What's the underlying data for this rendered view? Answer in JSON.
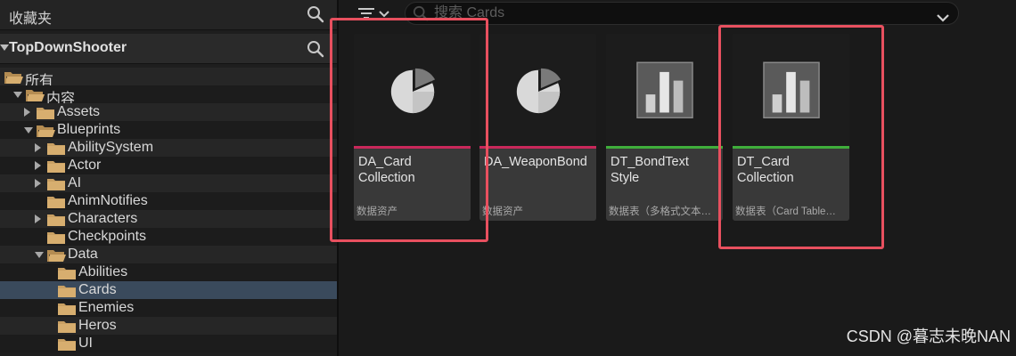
{
  "left_panel": {
    "favorites_label": "收藏夹",
    "project_name": "TopDownShooter",
    "tree": [
      {
        "label": "所有",
        "level": 0,
        "twisty": "none",
        "open_folder": true
      },
      {
        "label": "内容",
        "level": 1,
        "twisty": "open",
        "open_folder": true
      },
      {
        "label": "Assets",
        "level": 2,
        "twisty": "closed",
        "open_folder": false
      },
      {
        "label": "Blueprints",
        "level": 2,
        "twisty": "open",
        "open_folder": true
      },
      {
        "label": "AbilitySystem",
        "level": 3,
        "twisty": "closed",
        "open_folder": false
      },
      {
        "label": "Actor",
        "level": 3,
        "twisty": "closed",
        "open_folder": false
      },
      {
        "label": "AI",
        "level": 3,
        "twisty": "closed",
        "open_folder": false
      },
      {
        "label": "AnimNotifies",
        "level": 3,
        "twisty": "none",
        "open_folder": false
      },
      {
        "label": "Characters",
        "level": 3,
        "twisty": "closed",
        "open_folder": false
      },
      {
        "label": "Checkpoints",
        "level": 3,
        "twisty": "none",
        "open_folder": false
      },
      {
        "label": "Data",
        "level": 3,
        "twisty": "open",
        "open_folder": true
      },
      {
        "label": "Abilities",
        "level": 4,
        "twisty": "none",
        "open_folder": false
      },
      {
        "label": "Cards",
        "level": 4,
        "twisty": "none",
        "open_folder": false,
        "selected": true
      },
      {
        "label": "Enemies",
        "level": 4,
        "twisty": "none",
        "open_folder": false
      },
      {
        "label": "Heros",
        "level": 4,
        "twisty": "none",
        "open_folder": false
      },
      {
        "label": "UI",
        "level": 4,
        "twisty": "none",
        "open_folder": false
      }
    ]
  },
  "toolbar": {
    "search_placeholder": "搜索 Cards",
    "filter_icon": "filter-icon",
    "dropdown_icon": "chevron-down-icon"
  },
  "assets": [
    {
      "name": "DA_Card Collection",
      "type": "数据资产",
      "icon": "data-asset-icon",
      "bar_color": "#c8285a",
      "highlighted": true
    },
    {
      "name": "DA_WeaponBond",
      "type": "数据资产",
      "icon": "data-asset-icon",
      "bar_color": "#c8285a",
      "highlighted": false
    },
    {
      "name": "DT_BondText Style",
      "type": "数据表（多格式文本…",
      "icon": "data-table-icon",
      "bar_color": "#3fae3b",
      "highlighted": false
    },
    {
      "name": "DT_Card Collection",
      "type": "数据表（Card Table…",
      "icon": "data-table-icon",
      "bar_color": "#3fae3b",
      "highlighted": true
    }
  ],
  "watermark": "CSDN @暮志未晚NAN",
  "colors": {
    "highlight": "#e8505f",
    "folder": "#c9a063",
    "selected_row": "#3a4a5c"
  }
}
